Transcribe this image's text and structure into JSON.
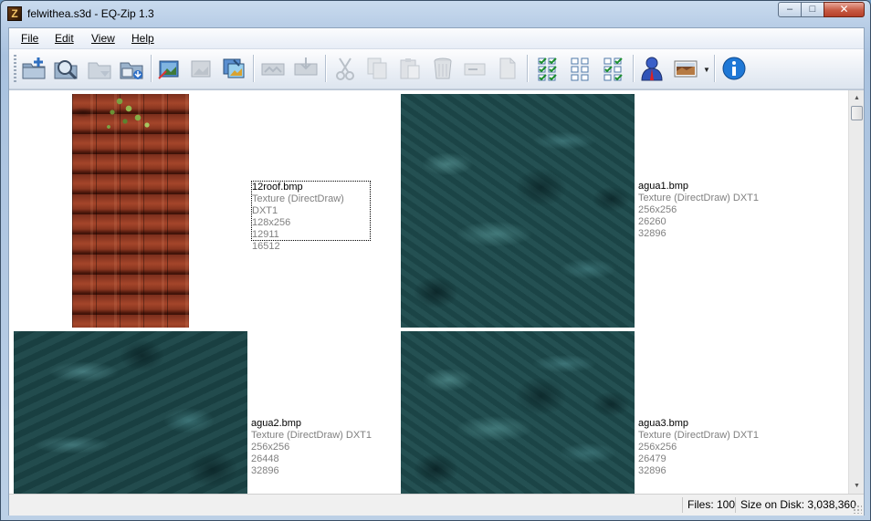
{
  "window": {
    "title": "felwithea.s3d - EQ-Zip 1.3",
    "app_icon_glyph": "Z",
    "min_glyph": "–",
    "max_glyph": "□",
    "close_glyph": "✕"
  },
  "menu": {
    "file_label": "File",
    "edit_label": "Edit",
    "view_label": "View",
    "help_label": "Help"
  },
  "toolbar": {
    "icons": [
      "new-archive-icon",
      "open-icon",
      "open-folder-icon",
      "save-icon",
      "import-icon",
      "export-icon",
      "extract-icon",
      "flip-icon",
      "merge-icon",
      "cut-icon",
      "copy-icon",
      "paste-icon",
      "delete-icon",
      "rename-icon",
      "properties-icon",
      "select-all-icon",
      "select-none-icon",
      "invert-selection-icon",
      "user-icon",
      "view-mode-icon",
      "about-icon"
    ],
    "dropdown_glyph": "▼"
  },
  "files": [
    {
      "name": "12roof.bmp",
      "type": "Texture (DirectDraw) DXT1",
      "dimensions": "128x256",
      "compressed": "12911",
      "size": "16512"
    },
    {
      "name": "agua1.bmp",
      "type": "Texture (DirectDraw) DXT1",
      "dimensions": "256x256",
      "compressed": "26260",
      "size": "32896"
    },
    {
      "name": "agua2.bmp",
      "type": "Texture (DirectDraw) DXT1",
      "dimensions": "256x256",
      "compressed": "26448",
      "size": "32896"
    },
    {
      "name": "agua3.bmp",
      "type": "Texture (DirectDraw) DXT1",
      "dimensions": "256x256",
      "compressed": "26479",
      "size": "32896"
    }
  ],
  "status": {
    "files": "Files: 100",
    "size_on_disk": "Size on Disk: 3,038,360"
  },
  "scrollbar": {
    "up_glyph": "▲",
    "down_glyph": "▼"
  }
}
